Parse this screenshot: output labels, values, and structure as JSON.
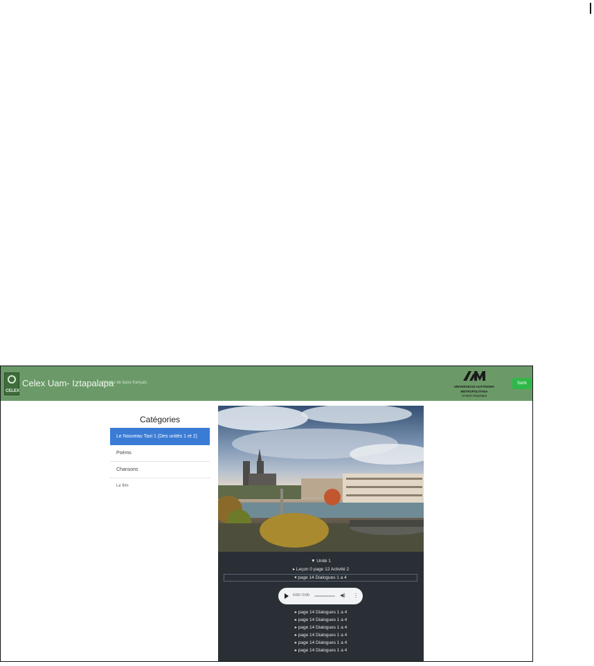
{
  "header": {
    "logo_text": "CELEX",
    "title": "Celex Uam- Iztapalapa",
    "tagline": "Niveau de base français",
    "university_line1": "UNIVERSIDAD AUTÓNOMA METROPOLITANA",
    "university_line2": "Unidad Iztapalapa",
    "login_label": "Sortir",
    "brand_color": "#6b9a68",
    "button_color": "#2fb84a"
  },
  "sidebar": {
    "title": "Catégories",
    "items": [
      {
        "label": "Le Nouveau Taxi 1 (Des unités 1 et 2)",
        "active": true
      },
      {
        "label": "Poèms",
        "active": false
      },
      {
        "label": "Chansons",
        "active": false
      },
      {
        "label": "Le film",
        "active": false
      }
    ],
    "active_color": "#3a7bd5"
  },
  "tree": {
    "unit": "▼ Unité 1",
    "lesson": "▸ Leçon 0 page 12 Activité 2",
    "selected": "▾ page 14 Dialogues 1 a 4",
    "items": [
      "▸ page 14 Dialogues 1 a 4",
      "▸ page 14 Dialogues 1 a 4",
      "▸ page 14 Dialogues 1 a 4",
      "▸ page 14 Dialogues 1 a 4",
      "▸ page 14 Dialogues 1 a 4",
      "▸ page 14 Dialogues 1 a 4"
    ]
  },
  "audio": {
    "time": "0:00 / 0:00",
    "play_icon": "play-icon",
    "volume_icon": "volume-icon",
    "more_icon": "more-vertical-icon"
  }
}
